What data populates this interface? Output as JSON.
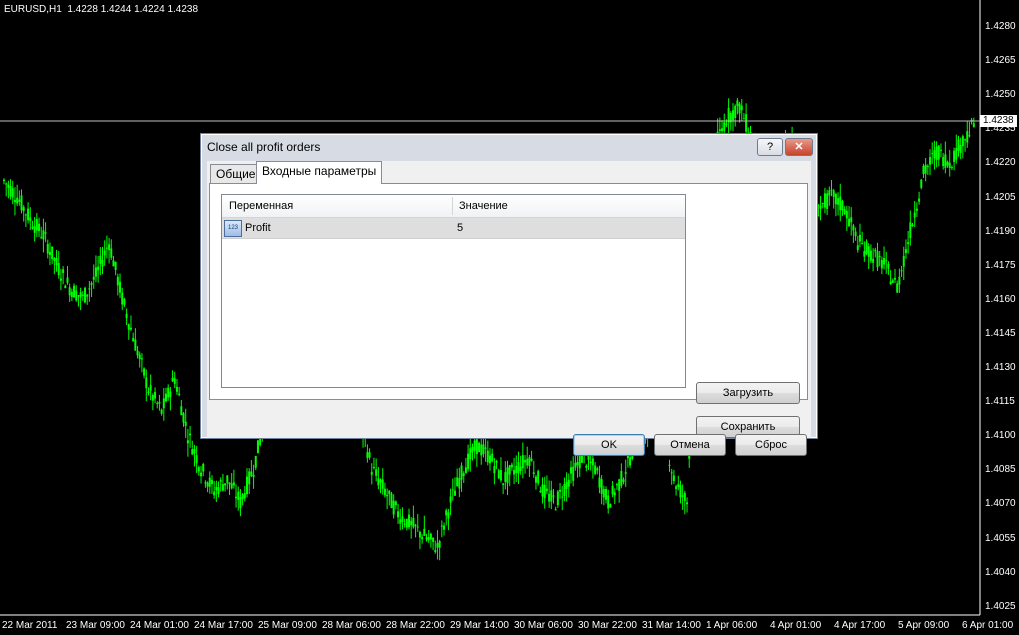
{
  "chart": {
    "title": "EURUSD,H1  1.4228 1.4244 1.4224 1.4238",
    "current_price": "1.4238",
    "price_labels": [
      "1.4280",
      "1.4265",
      "1.4250",
      "1.4235",
      "1.4220",
      "1.4205",
      "1.4190",
      "1.4175",
      "1.4160",
      "1.4145",
      "1.4130",
      "1.4115",
      "1.4100",
      "1.4085",
      "1.4070",
      "1.4055",
      "1.4040",
      "1.4025"
    ],
    "time_labels": [
      "22 Mar 2011",
      "23 Mar 09:00",
      "24 Mar 01:00",
      "24 Mar 17:00",
      "25 Mar 09:00",
      "28 Mar 06:00",
      "28 Mar 22:00",
      "29 Mar 14:00",
      "30 Mar 06:00",
      "30 Mar 22:00",
      "31 Mar 14:00",
      "1 Apr 06:00",
      "4 Apr 01:00",
      "4 Apr 17:00",
      "5 Apr 09:00",
      "6 Apr 01:00"
    ],
    "candle_color": "#00ff00",
    "chart_data": {
      "type": "line",
      "title": "EURUSD,H1  1.4228 1.4244 1.4224 1.4238",
      "xlabel": "",
      "ylabel": "",
      "ylim": [
        4.402,
        4.429
      ],
      "x_ticks": [
        "22 Mar 2011",
        "23 Mar 09:00",
        "24 Mar 01:00",
        "24 Mar 17:00",
        "25 Mar 09:00",
        "28 Mar 06:00",
        "28 Mar 22:00",
        "29 Mar 14:00",
        "30 Mar 06:00",
        "30 Mar 22:00",
        "31 Mar 14:00",
        "1 Apr 06:00",
        "4 Apr 01:00",
        "4 Apr 17:00",
        "5 Apr 09:00",
        "6 Apr 01:00"
      ],
      "y_ticks": [
        1.4025,
        1.404,
        1.4055,
        1.407,
        1.4085,
        1.41,
        1.4115,
        1.413,
        1.4145,
        1.416,
        1.4175,
        1.419,
        1.4205,
        1.422,
        1.4235,
        1.425,
        1.4265,
        1.428
      ],
      "series": [
        {
          "values": [
            1.4212,
            1.4205,
            1.4195,
            1.4188,
            1.4175,
            1.4165,
            1.416,
            1.417,
            1.4185,
            1.416,
            1.414,
            1.412,
            1.411,
            1.4125,
            1.41,
            1.4085,
            1.4075,
            1.408,
            1.407,
            1.4085,
            1.411,
            1.414,
            1.4175,
            1.42,
            1.421,
            1.419,
            1.415,
            1.411,
            1.4085,
            1.4075,
            1.4065,
            1.406,
            1.4055,
            1.405,
            1.407,
            1.4085,
            1.4095,
            1.409,
            1.408,
            1.4085,
            1.409,
            1.4075,
            1.407,
            1.408,
            1.409,
            1.4085,
            1.407,
            1.408,
            1.4095,
            1.41,
            1.411,
            1.408,
            1.407,
            1.4205,
            1.4225,
            1.424,
            1.4245,
            1.423,
            1.4215,
            1.4225,
            1.423,
            1.421,
            1.42,
            1.4205,
            1.42,
            1.4185,
            1.418,
            1.4175,
            1.4165,
            1.419,
            1.4215,
            1.4225,
            1.422,
            1.423,
            1.4238
          ]
        }
      ]
    }
  },
  "dialog": {
    "title": "Close all profit orders",
    "help_label": "?",
    "close_label": "✕",
    "tabs": [
      {
        "label": "Общие"
      },
      {
        "label": "Входные параметры"
      }
    ],
    "grid": {
      "columns": [
        "Переменная",
        "Значение"
      ],
      "rows": [
        {
          "icon": "123",
          "name": "Profit",
          "value": "5"
        }
      ]
    },
    "buttons": {
      "load": "Загрузить",
      "save": "Сохранить",
      "ok": "OK",
      "cancel": "Отмена",
      "reset": "Сброс"
    }
  }
}
